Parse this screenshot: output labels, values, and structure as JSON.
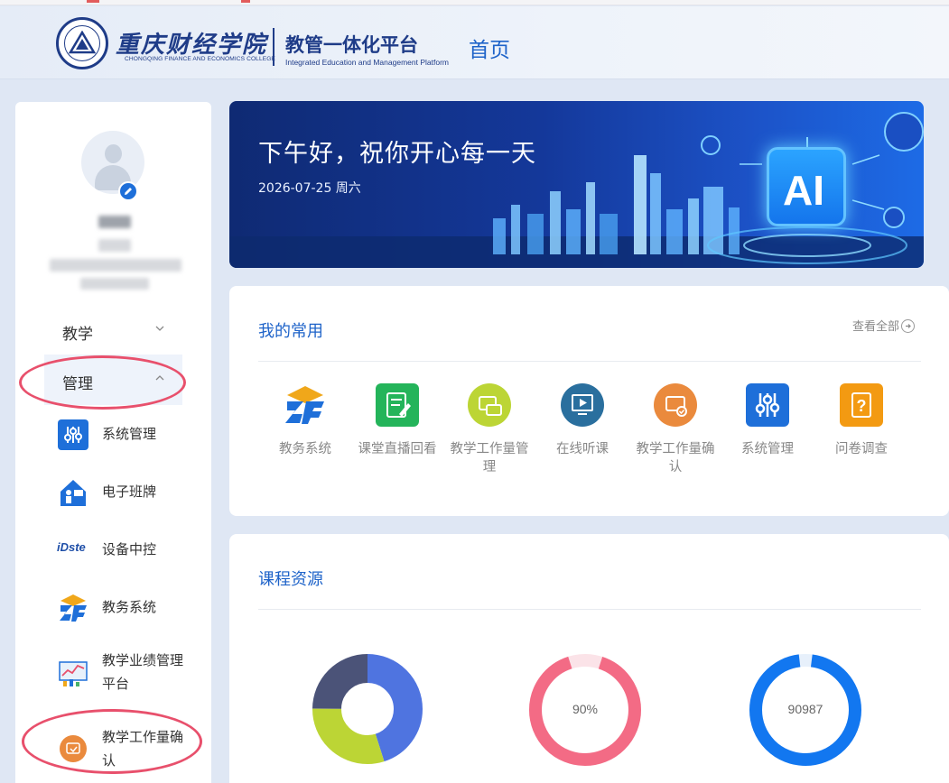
{
  "header": {
    "logo_cn": "重庆财经学院",
    "logo_en": "CHONGQING FINANCE AND ECONOMICS COLLEGE",
    "platform_cn": "教管一体化平台",
    "platform_en": "Integrated Education and Management Platform",
    "home_label": "首页"
  },
  "sidebar": {
    "groups": [
      {
        "label": "教学",
        "expanded": false
      },
      {
        "label": "管理",
        "expanded": true
      }
    ],
    "items": [
      {
        "label": "系统管理",
        "icon": "sliders-icon"
      },
      {
        "label": "电子班牌",
        "icon": "presenter-icon"
      },
      {
        "label": "设备中控",
        "icon": "idste-logo"
      },
      {
        "label": "教务系统",
        "icon": "zf-logo"
      },
      {
        "label": "教学业绩管理平台",
        "icon": "performance-chart-icon"
      },
      {
        "label": "教学工作量确认",
        "icon": "workload-confirm-icon"
      }
    ],
    "idste_text": "iDste"
  },
  "banner": {
    "greeting": "下午好，祝你开心每一天",
    "date": "2026-07-25 周六",
    "chip_text": "AI"
  },
  "favorites": {
    "title": "我的常用",
    "view_all": "查看全部",
    "items": [
      {
        "label": "教务系统",
        "icon": "zf-logo"
      },
      {
        "label": "课堂直播回看",
        "icon": "notepad-icon"
      },
      {
        "label": "教学工作量管理",
        "icon": "workload-manage-icon"
      },
      {
        "label": "在线听课",
        "icon": "play-board-icon"
      },
      {
        "label": "教学工作量确认",
        "icon": "workload-confirm-icon"
      },
      {
        "label": "系统管理",
        "icon": "sliders-icon"
      },
      {
        "label": "问卷调查",
        "icon": "question-icon"
      }
    ]
  },
  "resources": {
    "title": "课程资源",
    "donuts": [
      {
        "label": "",
        "segments": [
          0.45,
          0.3,
          0.25
        ],
        "colors": [
          "#4f74e0",
          "#bcd535",
          "#4b5378"
        ]
      },
      {
        "label": "90%",
        "value": 0.9,
        "color": "#f36b85",
        "track": "#fbe3e8"
      },
      {
        "label": "90987",
        "value": 0.96,
        "color": "#1277f0",
        "track": "#e7f0fb"
      }
    ]
  },
  "colors": {
    "accent": "#1e63c9",
    "brand": "#1f3c88",
    "annotation": "#e8506c"
  }
}
